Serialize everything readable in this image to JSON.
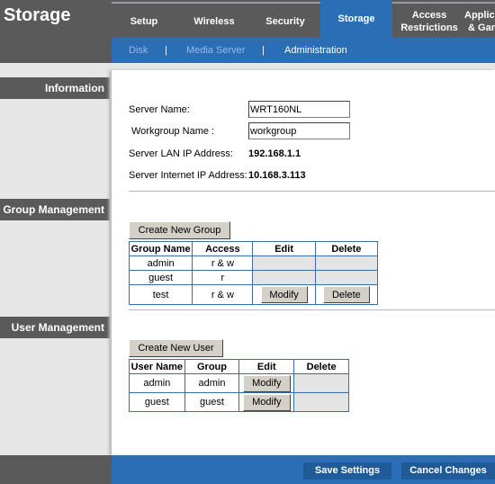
{
  "header": {
    "title": "Storage",
    "tabs": [
      {
        "label": "Setup"
      },
      {
        "label": "Wireless"
      },
      {
        "label": "Security"
      },
      {
        "label": "Storage",
        "active": true
      },
      {
        "label": "Access Restrictions"
      },
      {
        "label": "Applications & Gaming"
      }
    ],
    "subnav": [
      {
        "label": "Disk"
      },
      {
        "label": "Media Server"
      },
      {
        "label": "Administration",
        "active": true
      }
    ],
    "separator": "|"
  },
  "sidebar": {
    "sections": [
      {
        "label": "Information"
      },
      {
        "label": "Group Management"
      },
      {
        "label": "User Management"
      }
    ]
  },
  "information": {
    "server_name_label": "Server Name:",
    "server_name_value": "WRT160NL",
    "workgroup_label": "Workgroup Name :",
    "workgroup_value": "workgroup",
    "lan_ip_label": "Server LAN IP Address:",
    "lan_ip_value": "192.168.1.1",
    "internet_ip_label": "Server Internet IP Address:",
    "internet_ip_value": "10.168.3.113"
  },
  "groups": {
    "create_button": "Create New Group",
    "columns": [
      "Group Name",
      "Access",
      "Edit",
      "Delete"
    ],
    "rows": [
      {
        "name": "admin",
        "access": "r & w",
        "edit": "",
        "delete": ""
      },
      {
        "name": "guest",
        "access": "r",
        "edit": "",
        "delete": ""
      },
      {
        "name": "test",
        "access": "r & w",
        "edit": "Modify",
        "delete": "Delete"
      }
    ]
  },
  "users": {
    "create_button": "Create New User",
    "columns": [
      "User Name",
      "Group",
      "Edit",
      "Delete"
    ],
    "rows": [
      {
        "name": "admin",
        "group": "admin",
        "edit": "Modify",
        "delete": ""
      },
      {
        "name": "guest",
        "group": "guest",
        "edit": "Modify",
        "delete": ""
      }
    ]
  },
  "footer": {
    "save_label": "Save Settings",
    "cancel_label": "Cancel Changes"
  },
  "colors": {
    "accent_blue": "#2a6fb5",
    "header_gray": "#5a5a5a",
    "table_border": "#3a6ea5"
  }
}
